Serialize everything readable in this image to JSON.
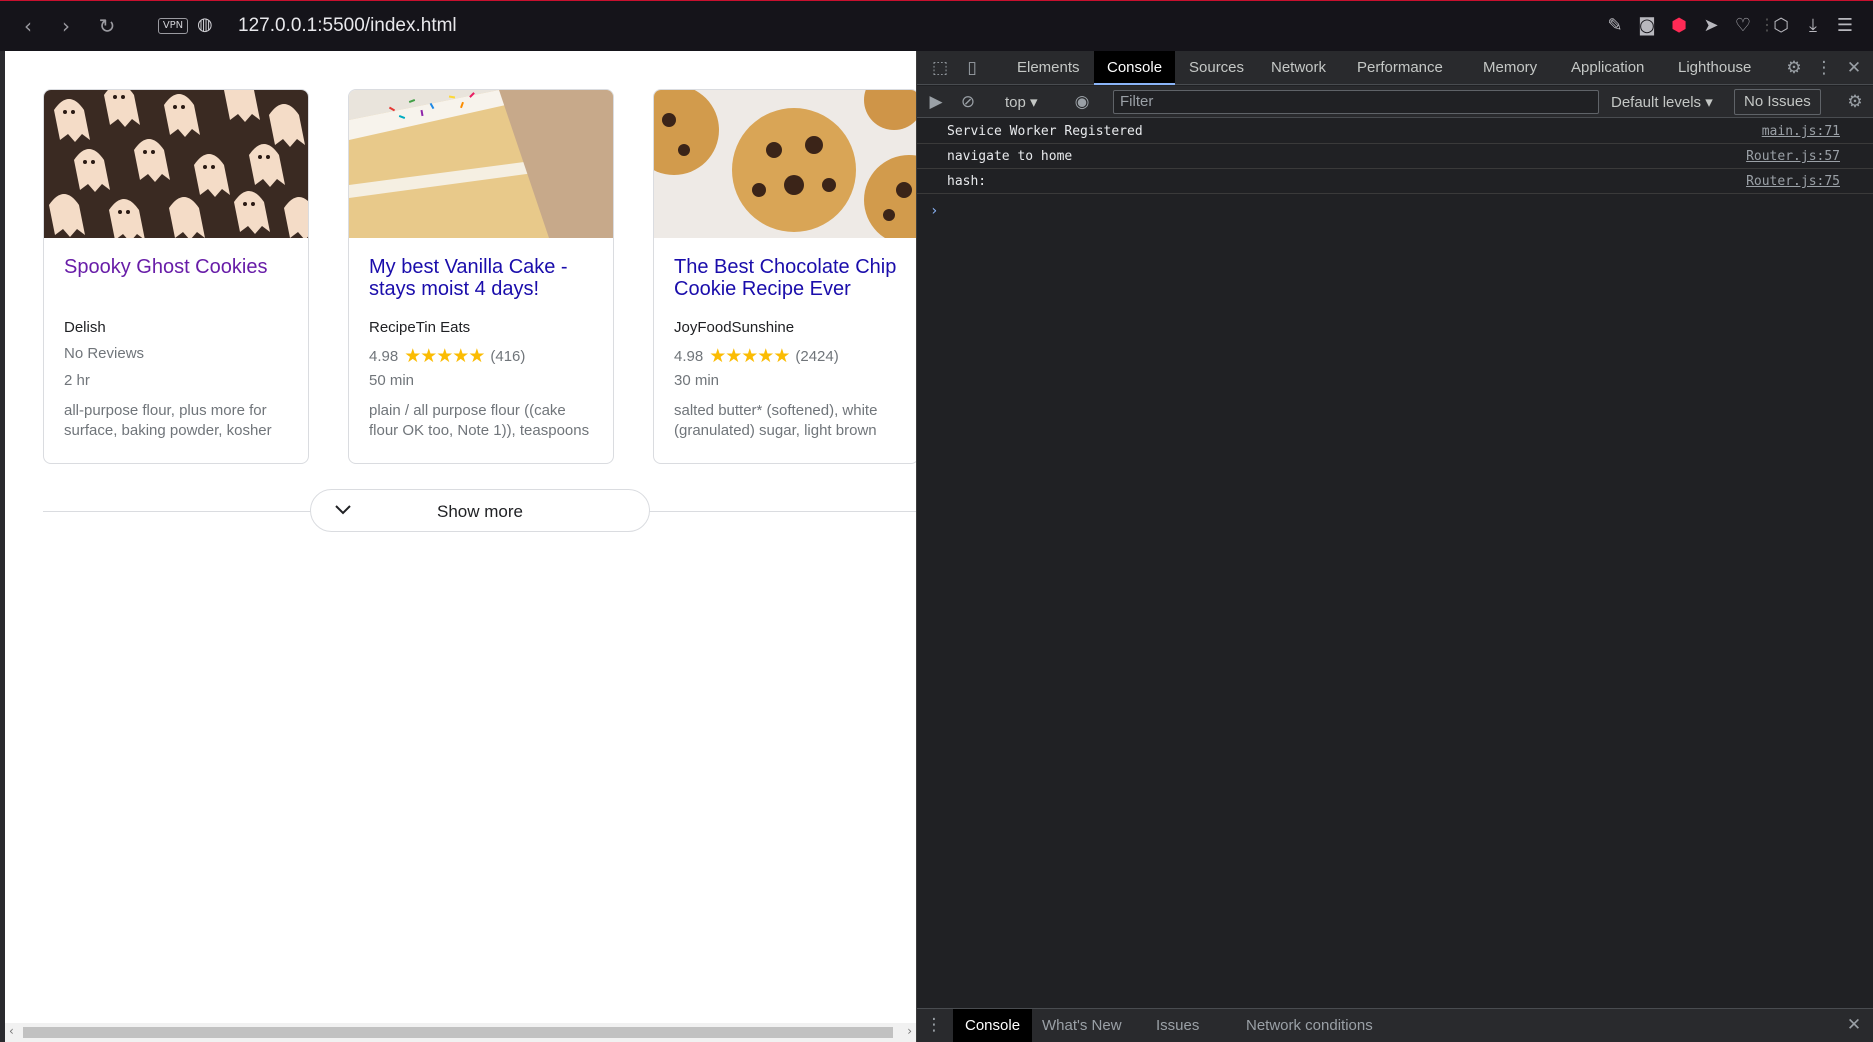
{
  "browser": {
    "url": "127.0.0.1:5500/index.html",
    "vpn_label": "VPN"
  },
  "recipes": [
    {
      "title": "Spooky Ghost Cookies",
      "source": "Delish",
      "reviews_text": "No Reviews",
      "time": "2 hr",
      "ingredients": "all-purpose flour, plus more for surface, baking powder, kosher",
      "image": "ghost-cookies-photo"
    },
    {
      "title": "My best Vanilla Cake - stays moist 4 days!",
      "source": "RecipeTin Eats",
      "rating": "4.98",
      "stars": "★★★★★",
      "review_count": "(416)",
      "time": "50 min",
      "ingredients": "plain / all purpose flour ((cake flour OK too, Note 1)), teaspoons",
      "image": "vanilla-cake-photo"
    },
    {
      "title": "The Best Chocolate Chip Cookie Recipe Ever",
      "source": "JoyFoodSunshine",
      "rating": "4.98",
      "stars": "★★★★★",
      "review_count": "(2424)",
      "time": "30 min",
      "ingredients": "salted butter* (softened), white (granulated) sugar, light brown",
      "image": "chocolate-chip-cookie-photo"
    }
  ],
  "show_more_label": "Show more",
  "devtools": {
    "tabs": [
      "Elements",
      "Console",
      "Sources",
      "Network",
      "Performance",
      "Memory",
      "Application",
      "Lighthouse"
    ],
    "active_tab": "Console",
    "context": "top",
    "filter_placeholder": "Filter",
    "levels": "Default levels",
    "issues": "No Issues",
    "logs": [
      {
        "message": "Service Worker Registered",
        "source": "main.js:71"
      },
      {
        "message": "navigate to home",
        "source": "Router.js:57"
      },
      {
        "message": "hash:",
        "source": "Router.js:75"
      }
    ],
    "drawer_tabs": [
      "Console",
      "What's New",
      "Issues",
      "Network conditions"
    ]
  },
  "colors": {
    "link": "#1a0dab",
    "visited": "#681da8",
    "star": "#fbbc04",
    "devtools_bg": "#202124"
  }
}
